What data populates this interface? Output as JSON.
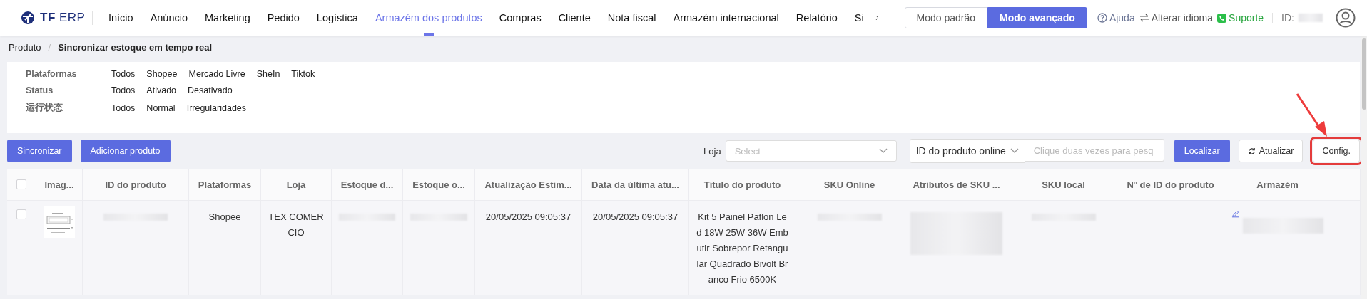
{
  "header": {
    "logo": "**TF** ERP",
    "menu": [
      {
        "label": "Início",
        "selected": false
      },
      {
        "label": "Anúncio",
        "selected": false
      },
      {
        "label": "Marketing",
        "selected": false
      },
      {
        "label": "Pedido",
        "selected": false
      },
      {
        "label": "Logística",
        "selected": false
      },
      {
        "label": "Armazém dos produtos",
        "selected": true
      },
      {
        "label": "Compras",
        "selected": false
      },
      {
        "label": "Cliente",
        "selected": false
      },
      {
        "label": "Nota fiscal",
        "selected": false
      },
      {
        "label": "Armazém internacional",
        "selected": false
      },
      {
        "label": "Relatório",
        "selected": false
      },
      {
        "label": "Si",
        "selected": false
      }
    ],
    "modes": [
      {
        "label": "Modo padrão",
        "selected": false
      },
      {
        "label": "Modo avançado",
        "selected": true
      }
    ],
    "links": [
      {
        "kind": "help",
        "label": "Ajuda"
      },
      {
        "kind": "language",
        "label": "Alterar idioma"
      },
      {
        "kind": "support",
        "label": "Suporte"
      }
    ],
    "id_label": "ID:"
  },
  "breadcrumb": {
    "items": [
      "Produto",
      "Sincronizar estoque em tempo real"
    ],
    "separator": "/"
  },
  "filters": [
    {
      "label": "Plataformas",
      "options": [
        {
          "label": "Todos",
          "selected": false
        },
        {
          "label": "Shopee",
          "selected": false
        },
        {
          "label": "Mercado Livre",
          "selected": false
        },
        {
          "label": "SheIn",
          "selected": false
        },
        {
          "label": "Tiktok",
          "selected": false
        }
      ]
    },
    {
      "label": "Status",
      "options": [
        {
          "label": "Todos",
          "selected": false
        },
        {
          "label": "Ativado",
          "selected": false
        },
        {
          "label": "Desativado",
          "selected": false
        }
      ]
    },
    {
      "label": "运行状态",
      "options": [
        {
          "label": "Todos",
          "selected": false
        },
        {
          "label": "Normal",
          "selected": false
        },
        {
          "label": "Irregularidades",
          "selected": false
        }
      ]
    }
  ],
  "actions": [
    "Sincronizar",
    "Adicionar produto"
  ],
  "search": {
    "store_label": "Loja",
    "store_placeholder": "Select",
    "field_type": "ID do produto online",
    "placeholder": "Clique duas vezes para pesq",
    "find": "Localizar",
    "refresh": "Atualizar",
    "config": "Config.",
    "config_highlighted": true
  },
  "table": {
    "header_checked": false,
    "columns": [
      "Imag...",
      "ID do produto",
      "Plataformas",
      "Loja",
      "Estoque d...",
      "Estoque o...",
      "Atualização Estim...",
      "Data da última atu...",
      "Título do produto",
      "SKU Online",
      "Atributos de SKU ...",
      "SKU local",
      "N° de ID do produto",
      "Armazém"
    ],
    "rows": [
      {
        "checked": false,
        "cells": [
          {
            "kind": "picture"
          },
          {
            "kind": "redacted"
          },
          {
            "kind": "text",
            "text": "Shopee"
          },
          {
            "kind": "text",
            "text": "TEX COMERCIO"
          },
          {
            "kind": "redacted"
          },
          {
            "kind": "redacted"
          },
          {
            "kind": "text",
            "text": "20/05/2025 09:05:37"
          },
          {
            "kind": "text",
            "text": "20/05/2025 09:05:37"
          },
          {
            "kind": "text",
            "text": "Kit 5 Painel Paflon Led 18W 25W 36W Embutir Sobrepor Retangular Quadrado Bivolt Branco Frio 6500K"
          },
          {
            "kind": "redacted"
          },
          {
            "kind": "redacted-large"
          },
          {
            "kind": "redacted"
          },
          {
            "kind": "empty"
          },
          {
            "kind": "edit-redacted"
          }
        ]
      }
    ]
  }
}
